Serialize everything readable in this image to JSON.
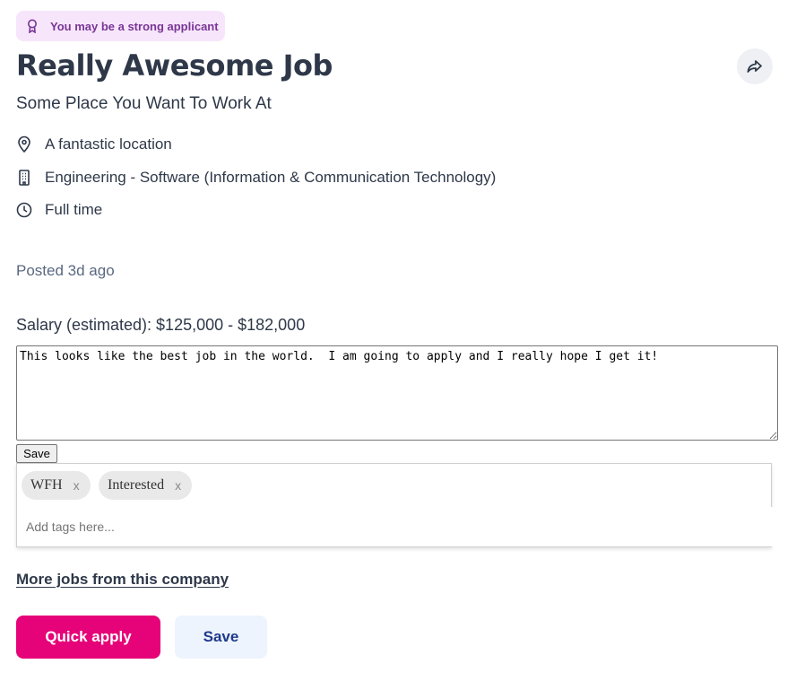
{
  "badge": {
    "label": "You may be a strong applicant",
    "icon": "ribbon-icon"
  },
  "job": {
    "title": "Really Awesome Job",
    "company": "Some Place You Want To Work At",
    "location": "A fantastic location",
    "classification": "Engineering - Software (Information & Communication Technology)",
    "work_type": "Full time",
    "posted": "Posted 3d ago",
    "salary": "Salary (estimated): $125,000 - $182,000"
  },
  "notes": {
    "value": "This looks like the best job in the world.  I am going to apply and I really hope I get it!",
    "save_label": "Save"
  },
  "tags": {
    "items": [
      {
        "label": "WFH",
        "remove": "x"
      },
      {
        "label": "Interested",
        "remove": "x"
      }
    ],
    "placeholder": "Add tags here..."
  },
  "more_jobs_link": "More jobs from this company",
  "actions": {
    "quick_apply": "Quick apply",
    "save": "Save"
  },
  "colors": {
    "accent": "#e60278",
    "badge_bg": "#f7e6fb",
    "badge_text": "#7a3597",
    "text": "#2e3849",
    "save_bg": "#eef4fd",
    "save_text": "#1e3a8a"
  }
}
